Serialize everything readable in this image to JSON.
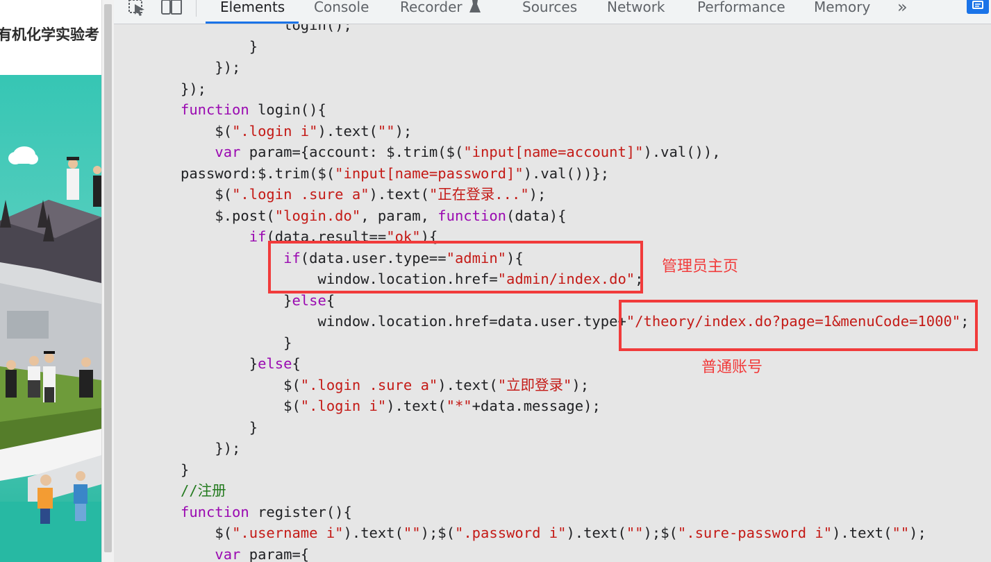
{
  "webpage": {
    "title": "有机化学实验考"
  },
  "devtools": {
    "tabs": [
      {
        "label": "Elements",
        "active": true
      },
      {
        "label": "Console",
        "active": false
      },
      {
        "label": "Recorder",
        "active": false
      },
      {
        "label": "Sources",
        "active": false
      },
      {
        "label": "Network",
        "active": false
      },
      {
        "label": "Performance",
        "active": false
      },
      {
        "label": "Memory",
        "active": false
      }
    ],
    "more_tabs_glyph": "»",
    "icons": [
      "inspect-element-icon",
      "device-toolbar-icon",
      "recorder-flask-icon",
      "chevron-double-right-icon",
      "feedback-chat-icon"
    ],
    "active_tab_color": "#1a73e8"
  },
  "code": {
    "lines": [
      {
        "segs": [
          {
            "c": "",
            "t": "            login();"
          }
        ]
      },
      {
        "segs": [
          {
            "c": "",
            "t": "        }"
          }
        ]
      },
      {
        "segs": [
          {
            "c": "",
            "t": "    });"
          }
        ]
      },
      {
        "segs": [
          {
            "c": "",
            "t": "});"
          }
        ]
      },
      {
        "segs": [
          {
            "c": "kw",
            "t": "function"
          },
          {
            "c": "",
            "t": " login(){"
          }
        ]
      },
      {
        "segs": [
          {
            "c": "",
            "t": "    $("
          },
          {
            "c": "str",
            "t": "\".login i\""
          },
          {
            "c": "",
            "t": ").text("
          },
          {
            "c": "str",
            "t": "\"\""
          },
          {
            "c": "",
            "t": ");"
          }
        ]
      },
      {
        "segs": [
          {
            "c": "",
            "t": "    "
          },
          {
            "c": "kw",
            "t": "var"
          },
          {
            "c": "",
            "t": " param={account: $.trim($("
          },
          {
            "c": "str",
            "t": "\"input[name=account]\""
          },
          {
            "c": "",
            "t": ").val()),"
          }
        ]
      },
      {
        "segs": [
          {
            "c": "",
            "t": "password:$.trim($("
          },
          {
            "c": "str",
            "t": "\"input[name=password]\""
          },
          {
            "c": "",
            "t": ").val())};"
          }
        ]
      },
      {
        "segs": [
          {
            "c": "",
            "t": "    $("
          },
          {
            "c": "str",
            "t": "\".login .sure a\""
          },
          {
            "c": "",
            "t": ").text("
          },
          {
            "c": "str",
            "t": "\"正在登录...\""
          },
          {
            "c": "",
            "t": ");"
          }
        ]
      },
      {
        "segs": [
          {
            "c": "",
            "t": "    $.post("
          },
          {
            "c": "str",
            "t": "\"login.do\""
          },
          {
            "c": "",
            "t": ", param, "
          },
          {
            "c": "kw",
            "t": "function"
          },
          {
            "c": "",
            "t": "(data){"
          }
        ]
      },
      {
        "segs": [
          {
            "c": "",
            "t": "        "
          },
          {
            "c": "kw",
            "t": "if"
          },
          {
            "c": "",
            "t": "(data.result=="
          },
          {
            "c": "str",
            "t": "\"ok\""
          },
          {
            "c": "",
            "t": "){"
          }
        ]
      },
      {
        "segs": [
          {
            "c": "",
            "t": "            "
          },
          {
            "c": "kw",
            "t": "if"
          },
          {
            "c": "",
            "t": "(data.user.type=="
          },
          {
            "c": "str",
            "t": "\"admin\""
          },
          {
            "c": "",
            "t": "){"
          }
        ]
      },
      {
        "segs": [
          {
            "c": "",
            "t": "                window.location.href="
          },
          {
            "c": "str",
            "t": "\"admin/index.do\""
          },
          {
            "c": "",
            "t": ";"
          }
        ]
      },
      {
        "segs": [
          {
            "c": "",
            "t": "            }"
          },
          {
            "c": "kw",
            "t": "else"
          },
          {
            "c": "",
            "t": "{"
          }
        ]
      },
      {
        "segs": [
          {
            "c": "",
            "t": "                window.location.href=data.user.type+"
          },
          {
            "c": "str",
            "t": "\"/theory/index.do?page=1&menuCode=1000\""
          },
          {
            "c": "",
            "t": ";"
          }
        ]
      },
      {
        "segs": [
          {
            "c": "",
            "t": "            }"
          }
        ]
      },
      {
        "segs": [
          {
            "c": "",
            "t": "        }"
          },
          {
            "c": "kw",
            "t": "else"
          },
          {
            "c": "",
            "t": "{"
          }
        ]
      },
      {
        "segs": [
          {
            "c": "",
            "t": "            $("
          },
          {
            "c": "str",
            "t": "\".login .sure a\""
          },
          {
            "c": "",
            "t": ").text("
          },
          {
            "c": "str",
            "t": "\"立即登录\""
          },
          {
            "c": "",
            "t": ");"
          }
        ]
      },
      {
        "segs": [
          {
            "c": "",
            "t": "            $("
          },
          {
            "c": "str",
            "t": "\".login i\""
          },
          {
            "c": "",
            "t": ").text("
          },
          {
            "c": "str",
            "t": "\"*\""
          },
          {
            "c": "",
            "t": "+data.message);"
          }
        ]
      },
      {
        "segs": [
          {
            "c": "",
            "t": "        }"
          }
        ]
      },
      {
        "segs": [
          {
            "c": "",
            "t": "    });"
          }
        ]
      },
      {
        "segs": [
          {
            "c": "",
            "t": "}"
          }
        ]
      },
      {
        "segs": [
          {
            "c": "cmt",
            "t": "//注册"
          }
        ]
      },
      {
        "segs": [
          {
            "c": "kw",
            "t": "function"
          },
          {
            "c": "",
            "t": " register(){"
          }
        ]
      },
      {
        "segs": [
          {
            "c": "",
            "t": "    $("
          },
          {
            "c": "str",
            "t": "\".username i\""
          },
          {
            "c": "",
            "t": ").text("
          },
          {
            "c": "str",
            "t": "\"\""
          },
          {
            "c": "",
            "t": ");$("
          },
          {
            "c": "str",
            "t": "\".password i\""
          },
          {
            "c": "",
            "t": ").text("
          },
          {
            "c": "str",
            "t": "\"\""
          },
          {
            "c": "",
            "t": ");$("
          },
          {
            "c": "str",
            "t": "\".sure-password i\""
          },
          {
            "c": "",
            "t": ").text("
          },
          {
            "c": "str",
            "t": "\"\""
          },
          {
            "c": "",
            "t": ");"
          }
        ]
      },
      {
        "segs": [
          {
            "c": "",
            "t": "    "
          },
          {
            "c": "kw",
            "t": "var"
          },
          {
            "c": "",
            "t": " param={"
          }
        ]
      }
    ],
    "colors": {
      "keyword": "#9a0ab1",
      "string": "#c41a16",
      "comment": "#237a1e",
      "text": "#202124",
      "background": "#e6e6e6"
    }
  },
  "annotations": {
    "admin_label": "管理员主页",
    "normal_label": "普通账号",
    "color": "#f13b3b"
  }
}
